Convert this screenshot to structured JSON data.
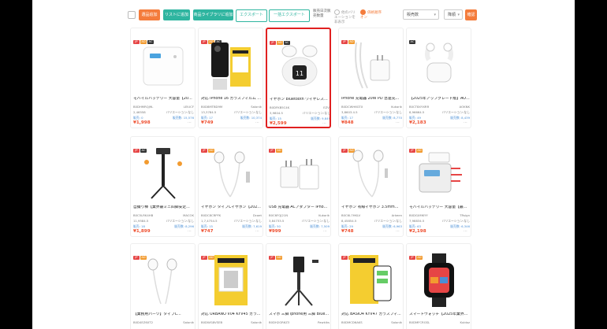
{
  "toolbar": {
    "buttons": [
      {
        "label": "選品追加",
        "style": "orange"
      },
      {
        "label": "リストに追加",
        "style": "green"
      },
      {
        "label": "商品ライブラリに追加",
        "style": "green"
      },
      {
        "label": "エクスポート",
        "style": "ghost"
      },
      {
        "label": "一括エクスポート",
        "style": "ghost"
      }
    ],
    "sales_label": "販売日次販売数量",
    "filter_toggle": "他のバリエーションを非表示",
    "filter_toggle2": "価格順序オン",
    "sort_select": "販売数",
    "order_select": "降順",
    "confirm_label": "確認"
  },
  "products": [
    {
      "badges": [
        [
          "r",
          "JP"
        ],
        [
          "o",
          "AD"
        ],
        [
          "k",
          "AC"
        ]
      ],
      "title": "モバイルバッテリー 大容量【2025...",
      "asin": "B0DHMRQJ9L",
      "brand": "LEIUCF",
      "ranking": "2,46558",
      "variation": "バリエーション:なし",
      "sales": "販売: 0",
      "monthly_sales": "販売数: 15,576",
      "price": "¥1,998",
      "img": "powerbank-white"
    },
    {
      "badges": [
        [
          "r",
          "JP"
        ],
        [
          "o",
          "AD"
        ],
        [
          "k",
          "AC"
        ]
      ],
      "title": "対応 iPhone 16 ガラスフィルム a...",
      "asin": "B0D8MTBD9M",
      "brand": "Salonik",
      "ranking": "13,3784.5",
      "variation": "バリエーション:なし",
      "sales": "販売: 17",
      "monthly_sales": "販売数: 10,374",
      "price": "¥749",
      "img": "glass-film"
    },
    {
      "badges": [
        [
          "r",
          "JP"
        ],
        [
          "o",
          "AD"
        ],
        [
          "k",
          "AC"
        ]
      ],
      "title": "イヤホン bluetooth ワイヤレスイ...",
      "asin": "B0DFKB5C4K",
      "brand": "EZVJ",
      "ranking": "3,9804.5",
      "variation": "バリエーション:なし",
      "sales": "販売: 15",
      "monthly_sales": "販売数: 9,849",
      "price": "¥2,599",
      "img": "earbuds-case",
      "highlighted": true
    },
    {
      "badges": [
        [
          "r",
          "JP"
        ],
        [
          "o",
          "AD"
        ]
      ],
      "title": "iPhone 充電器 20W PD 急速充電 ...",
      "asin": "B0DCWH6GTX",
      "brand": "Kukorik",
      "ranking": "3,8603.4.5",
      "variation": "バリエーション:なし",
      "sales": "販売: 17",
      "monthly_sales": "販売数: 8,770",
      "price": "¥848",
      "img": "charger-cable"
    },
    {
      "badges": [
        [
          "k",
          "AC"
        ]
      ],
      "title": "【2025年アップグレード版】AOK...",
      "asin": "B0CT8XYXRR",
      "brand": "AOKNK",
      "ranking": "8,96664.5",
      "variation": "バリエーション:なし",
      "sales": "販売: 49",
      "monthly_sales": "販売数: 8,439",
      "price": "¥2,183",
      "img": "earbuds-white"
    },
    {
      "badges": [
        [
          "r",
          "JP"
        ],
        [
          "k",
          "AC"
        ]
      ],
      "title": "自撮り棒【業界最ミニ四脚安定...",
      "asin": "B0C5LRK4HB",
      "brand": "MACOK",
      "ranking": "11,9584.5",
      "variation": "バリエーション:なし",
      "sales": "販売: 18",
      "monthly_sales": "販売数: 8,296",
      "price": "¥1,899",
      "img": "selfie-stick"
    },
    {
      "badges": [
        [
          "r",
          "JP"
        ],
        [
          "o",
          "AD"
        ]
      ],
      "title": "イヤホン タイプCイヤホン【202...",
      "asin": "B0DC8CRPFK",
      "brand": "Dcaet",
      "ranking": "1,7,4754.5",
      "variation": "バリエーション:なし",
      "sales": "販売: 15",
      "monthly_sales": "販売数: 7,619",
      "price": "¥747",
      "img": "wired-earphones"
    },
    {
      "badges": [
        [
          "r",
          "JP"
        ],
        [
          "o",
          "AD"
        ]
      ],
      "title": "USB 充電器 ACアダプター iPhon...",
      "asin": "B0C6FQJ21N",
      "brand": "Kukorik",
      "ranking": "3,84733.5",
      "variation": "バリエーション:なし",
      "sales": "販売: 50",
      "monthly_sales": "販売数: 7,509",
      "price": "¥999",
      "img": "usb-adapter"
    },
    {
      "badges": [
        [
          "r",
          "JP"
        ],
        [
          "o",
          "AD"
        ]
      ],
      "title": "イヤホン 有線イヤホン 3.5mmプ...",
      "asin": "B0C6L7HKLV",
      "brand": "Arkeen",
      "ranking": "8,45854.5",
      "variation": "バリエーション:なし",
      "sales": "販売: 29",
      "monthly_sales": "販売数: 6,963",
      "price": "¥748",
      "img": "wired-earphones-2"
    },
    {
      "badges": [
        [
          "r",
          "JP"
        ],
        [
          "o",
          "AD"
        ]
      ],
      "title": "モバイルバッテリー 大容量【最...",
      "asin": "B0DGXMKYY",
      "brand": "TRsign",
      "ranking": "7,98834.5",
      "variation": "バリエーション:なし",
      "sales": "販売: 63",
      "monthly_sales": "販売数: 6,346",
      "price": "¥2,198",
      "img": "powerbank-cables"
    },
    {
      "badges": [
        [
          "r",
          "JP"
        ],
        [
          "o",
          "AD"
        ]
      ],
      "title": "【業務用パーツ】タイプC...",
      "asin": "B0D4EZ6XT2",
      "brand": "Salonik",
      "ranking": "",
      "variation": "",
      "sales": "",
      "monthly_sales": "",
      "price": "",
      "img": "earphones-white"
    },
    {
      "badges": [
        [
          "r",
          "JP"
        ],
        [
          "o",
          "AD"
        ]
      ],
      "title": "対応 URBANO V04 KYV45 ガラス...",
      "asin": "B0DWG8VSEB",
      "brand": "Salonik",
      "ranking": "",
      "variation": "",
      "sales": "",
      "monthly_sales": "",
      "price": "",
      "img": "yellow-box"
    },
    {
      "badges": [
        [
          "r",
          "JP"
        ],
        [
          "o",
          "AD"
        ]
      ],
      "title": "スマホ 三脚 iphone用 三脚 Bluet...",
      "asin": "B0DH2GR6Z3",
      "brand": "Pawkiks",
      "ranking": "",
      "variation": "",
      "sales": "",
      "monthly_sales": "",
      "price": "",
      "img": "tripod"
    },
    {
      "badges": [
        [
          "r",
          "JP"
        ],
        [
          "o",
          "AD"
        ]
      ],
      "title": "対応 BASIO4 KYV47 ガラスフィ...",
      "asin": "B0DMCD6AKS",
      "brand": "Salonik",
      "ranking": "",
      "variation": "",
      "sales": "",
      "monthly_sales": "",
      "price": "",
      "img": "yellow-box-phone"
    },
    {
      "badges": [
        [
          "r",
          "JP"
        ],
        [
          "o",
          "AD"
        ]
      ],
      "title": "スマートウォッチ【2025年業界最...",
      "asin": "B0DMFCRGSL",
      "brand": "Kuldoz",
      "ranking": "",
      "variation": "",
      "sales": "",
      "monthly_sales": "",
      "price": "",
      "img": "smartwatch"
    }
  ]
}
